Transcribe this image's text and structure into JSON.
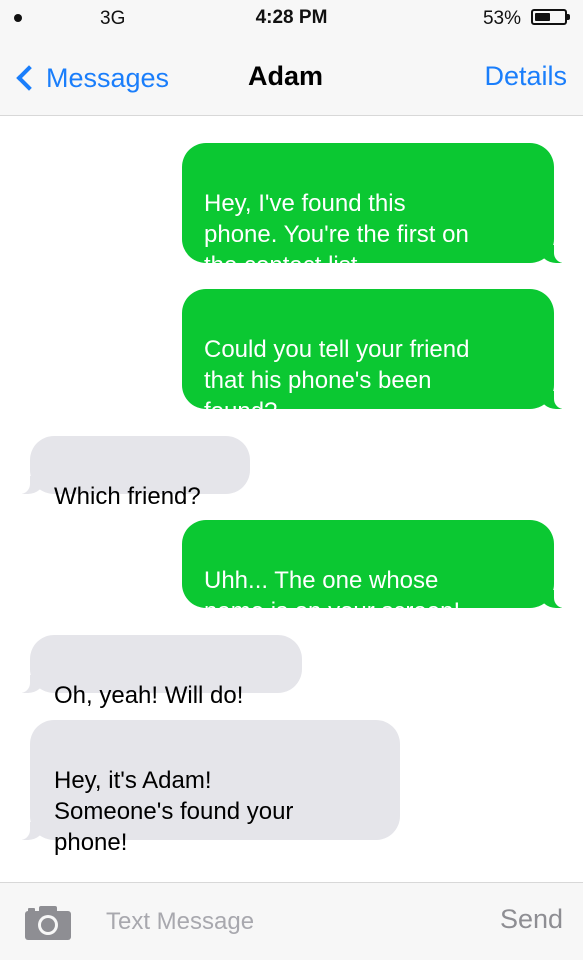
{
  "status_bar": {
    "carrier": "3G",
    "time": "4:28 PM",
    "battery_percent": "53%",
    "battery_level": 0.53
  },
  "nav": {
    "back_label": "Messages",
    "title": "Adam",
    "details_label": "Details"
  },
  "colors": {
    "sent_bubble": "#0bc832",
    "received_bubble": "#e5e5ea",
    "accent": "#1a7efb"
  },
  "messages": [
    {
      "direction": "sent",
      "text": "Hey, I've found this\nphone. You're the first on\nthe contact list."
    },
    {
      "direction": "sent",
      "text": "Could you tell your friend\nthat his phone's been\nfound?"
    },
    {
      "direction": "received",
      "text": "Which friend?"
    },
    {
      "direction": "sent",
      "text": "Uhh... The one whose\nname is on your screen!"
    },
    {
      "direction": "received",
      "text": "Oh, yeah! Will do!"
    },
    {
      "direction": "received",
      "text": "Hey, it's Adam!\nSomeone's found your\nphone!"
    }
  ],
  "input_bar": {
    "camera_icon": "camera-icon",
    "placeholder": "Text Message",
    "value": "",
    "send_label": "Send"
  }
}
